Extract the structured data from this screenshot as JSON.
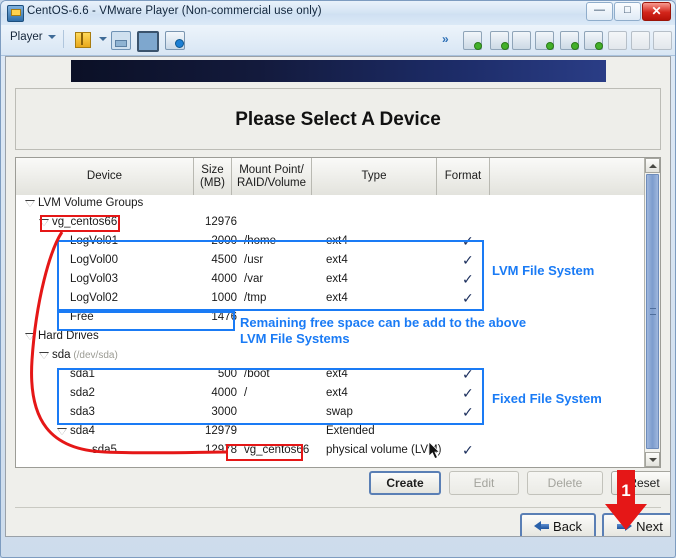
{
  "window": {
    "title": "CentOS-6.6 - VMware Player (Non-commercial use only)",
    "minimize_label": "—",
    "maximize_label": "□",
    "close_label": "✕"
  },
  "toolbar": {
    "player_menu": "Player",
    "left_icons": [
      "pause-icon",
      "unity-icon",
      "fullscreen-icon",
      "help-icon"
    ],
    "right_icons": [
      "chevrons-right-icon",
      "removable-devices-icon",
      "cd-dvd-icon",
      "floppy-icon",
      "network-adapter-icon",
      "printer-icon",
      "usb-controller-icon",
      "display-icon",
      "shared-folders-icon",
      "send-key-icon"
    ]
  },
  "installer": {
    "heading": "Please Select A Device",
    "table": {
      "columns": [
        {
          "label": "Device"
        },
        {
          "label": "Size\n(MB)",
          "line1": "Size",
          "line2": "(MB)"
        },
        {
          "label": "Mount Point/\nRAID/Volume",
          "line1": "Mount Point/",
          "line2": "RAID/Volume"
        },
        {
          "label": "Type"
        },
        {
          "label": "Format"
        }
      ],
      "rows": [
        {
          "kind": "group",
          "indent": 0,
          "expander": "expanded",
          "device": "LVM Volume Groups",
          "size": "",
          "mount": "",
          "type": "",
          "format": ""
        },
        {
          "kind": "vg",
          "indent": 1,
          "expander": "expanded",
          "device": "vg_centos66",
          "size": "12976",
          "mount": "",
          "type": "",
          "format": ""
        },
        {
          "kind": "lv",
          "indent": 2,
          "expander": "none",
          "device": "LogVol01",
          "size": "2000",
          "mount": "/home",
          "type": "ext4",
          "format": "✓"
        },
        {
          "kind": "lv",
          "indent": 2,
          "expander": "none",
          "device": "LogVol00",
          "size": "4500",
          "mount": "/usr",
          "type": "ext4",
          "format": "✓"
        },
        {
          "kind": "lv",
          "indent": 2,
          "expander": "none",
          "device": "LogVol03",
          "size": "4000",
          "mount": "/var",
          "type": "ext4",
          "format": "✓"
        },
        {
          "kind": "lv",
          "indent": 2,
          "expander": "none",
          "device": "LogVol02",
          "size": "1000",
          "mount": "/tmp",
          "type": "ext4",
          "format": "✓"
        },
        {
          "kind": "free",
          "indent": 2,
          "expander": "none",
          "device": "Free",
          "size": "1476",
          "mount": "",
          "type": "",
          "format": ""
        },
        {
          "kind": "group",
          "indent": 0,
          "expander": "expanded",
          "device": "Hard Drives",
          "size": "",
          "mount": "",
          "type": "",
          "format": ""
        },
        {
          "kind": "disk",
          "indent": 1,
          "expander": "expanded",
          "device": "sda",
          "device_path": "(/dev/sda)",
          "size": "",
          "mount": "",
          "type": "",
          "format": ""
        },
        {
          "kind": "part",
          "indent": 2,
          "expander": "none",
          "device": "sda1",
          "size": "500",
          "mount": "/boot",
          "type": "ext4",
          "format": "✓"
        },
        {
          "kind": "part",
          "indent": 2,
          "expander": "none",
          "device": "sda2",
          "size": "4000",
          "mount": "/",
          "type": "ext4",
          "format": "✓"
        },
        {
          "kind": "part",
          "indent": 2,
          "expander": "none",
          "device": "sda3",
          "size": "3000",
          "mount": "",
          "type": "swap",
          "format": "✓"
        },
        {
          "kind": "part",
          "indent": 2,
          "expander": "expanded",
          "device": "sda4",
          "size": "12979",
          "mount": "",
          "type": "Extended",
          "format": ""
        },
        {
          "kind": "part",
          "indent": 3,
          "expander": "none",
          "device": "sda5",
          "size": "12978",
          "mount": "vg_centos66",
          "type": "physical volume (LVM)",
          "format": "✓"
        }
      ]
    },
    "action_buttons": [
      {
        "label": "Create",
        "state": "enabled",
        "name": "create-button"
      },
      {
        "label": "Edit",
        "state": "disabled",
        "name": "edit-button"
      },
      {
        "label": "Delete",
        "state": "disabled",
        "name": "delete-button"
      },
      {
        "label": "Reset",
        "state": "enabled",
        "name": "reset-button"
      }
    ],
    "nav_buttons": [
      {
        "label": "Back",
        "icon": "arrow-left-icon",
        "name": "back-button"
      },
      {
        "label": "Next",
        "icon": "arrow-right-icon",
        "name": "next-button"
      }
    ]
  },
  "annotations": {
    "color_blue": "#1a7bf5",
    "color_red": "#e51717",
    "labels": [
      {
        "id": "lvm-fs",
        "text": "LVM File System"
      },
      {
        "id": "free-note-line1",
        "text": "Remaining free space can be add to the above"
      },
      {
        "id": "free-note-line2",
        "text": "LVM File Systems"
      },
      {
        "id": "fixed-fs",
        "text": "Fixed File System"
      }
    ],
    "step_marker": "1"
  }
}
